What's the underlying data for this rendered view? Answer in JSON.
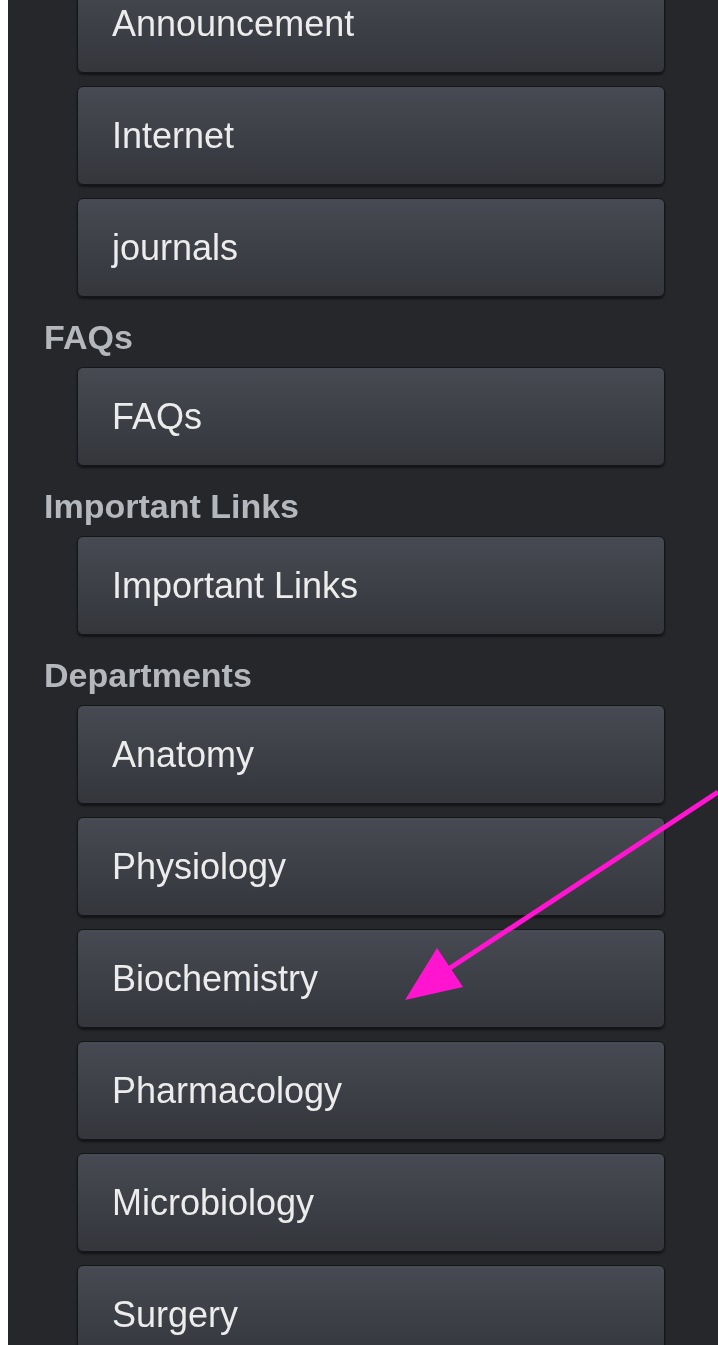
{
  "sections": [
    {
      "items": [
        "Announcement",
        "Internet",
        "journals"
      ]
    },
    {
      "heading": "FAQs",
      "items": [
        "FAQs"
      ]
    },
    {
      "heading": "Important Links",
      "items": [
        "Important Links"
      ]
    },
    {
      "heading": "Departments",
      "items": [
        "Anatomy",
        "Physiology",
        "Biochemistry",
        "Pharmacology",
        "Microbiology",
        "Surgery"
      ]
    }
  ]
}
